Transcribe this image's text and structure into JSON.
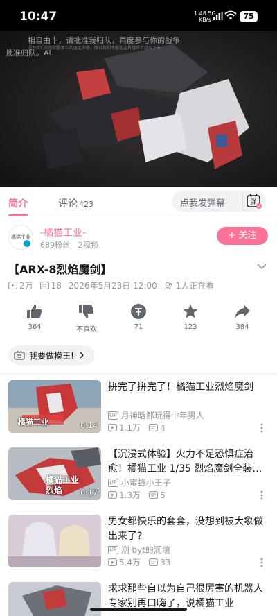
{
  "status_bar": {
    "time": "10:47",
    "net_speed": "1.48",
    "net_unit": "KB/s",
    "net_type": "5G",
    "battery": "75"
  },
  "video": {
    "danmaku": [
      "相自由十，请批准我归队，再度参与你的战争",
      "批准归队。AL"
    ],
    "danmaku_small": "因为我们的信仰是那么的坚定不移，所以我们才能在这片战场上战斗下去"
  },
  "tabs": {
    "intro": "简介",
    "comments": "评论",
    "comments_count": "423"
  },
  "danmaku_input": {
    "placeholder": "点我发弹幕",
    "icon_label": "弹"
  },
  "uploader": {
    "avatar_text": "橘猫工业",
    "name": "-橘猫工业-",
    "fans": "689粉丝",
    "videos": "2视频",
    "follow_label": "+ 关注"
  },
  "video_info": {
    "title": "【ARX-8烈焰魔剑】",
    "views": "2万",
    "danmaku_count": "18",
    "date": "2026年5月23日 12:00",
    "watching": "1人正在看"
  },
  "actions": {
    "like": "364",
    "dislike": "不喜欢",
    "coin": "71",
    "favorite": "123",
    "share": "384"
  },
  "tag": {
    "label": "我要做模王!"
  },
  "related": [
    {
      "title": "拼完了拼完了！橘猫工业烈焰魔剑",
      "uploader": "月神晗都玩得中年男人",
      "views": "1.1万",
      "danmaku": "4",
      "duration": "0:14",
      "thumb_text": "橘猫工业"
    },
    {
      "title": "【沉浸式体验】火力不足恐惧症治愈！橘猫工业 1/35 烈焰魔剑全装…",
      "uploader": "小蜜蜂小王子",
      "views": "1.3万",
      "danmaku": "5",
      "duration": "0:17",
      "thumb_text": "橘猫工业 烈焰"
    },
    {
      "title": "男女都快乐的套套，没想到被大象做出来了?",
      "uploader": "测 byt的润壤",
      "views": "5.4万",
      "danmaku": "33"
    },
    {
      "title": "求求那些自以为自己很厉害的机器人专家别再口嗨了，说橘猫工业"
    }
  ],
  "colors": {
    "accent": "#fb7299",
    "muted": "#9499a0",
    "text": "#18191c"
  }
}
